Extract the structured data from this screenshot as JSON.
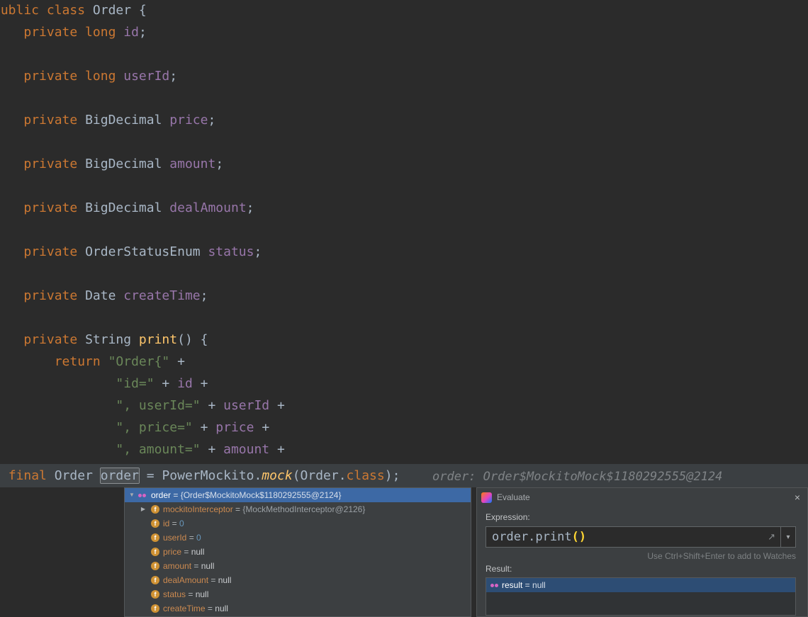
{
  "palette": {
    "editor_bg": "#2b2b2b",
    "panel_bg": "#3c3f41",
    "keyword": "#cc7832",
    "identifier": "#a9b7c6",
    "field": "#9876aa",
    "method": "#ffc66b",
    "string": "#6a8759",
    "number": "#6897bb",
    "selection_blue": "#3d69a5",
    "result_selection_blue": "#2d4d74",
    "execution_line_bg": "#3b3f42"
  },
  "icons": {
    "close": "×",
    "dropdown": "▾",
    "expand": "↗",
    "chevron_expanded": "▼",
    "chevron_collapsed": "▶",
    "field_letter": "f"
  },
  "editor": {
    "lines": [
      [
        {
          "t": "public ",
          "c": "kw"
        },
        {
          "t": "class ",
          "c": "kw"
        },
        {
          "t": "Order ",
          "c": "plain"
        },
        {
          "t": "{",
          "c": "plain"
        }
      ],
      [
        {
          "t": "    ",
          "c": "plain"
        },
        {
          "t": "private long ",
          "c": "kw"
        },
        {
          "t": "id",
          "c": "field"
        },
        {
          "t": ";",
          "c": "plain"
        }
      ],
      [],
      [
        {
          "t": "    ",
          "c": "plain"
        },
        {
          "t": "private long ",
          "c": "kw"
        },
        {
          "t": "userId",
          "c": "field"
        },
        {
          "t": ";",
          "c": "plain"
        }
      ],
      [],
      [
        {
          "t": "    ",
          "c": "plain"
        },
        {
          "t": "private ",
          "c": "kw"
        },
        {
          "t": "BigDecimal ",
          "c": "plain"
        },
        {
          "t": "price",
          "c": "field"
        },
        {
          "t": ";",
          "c": "plain"
        }
      ],
      [],
      [
        {
          "t": "    ",
          "c": "plain"
        },
        {
          "t": "private ",
          "c": "kw"
        },
        {
          "t": "BigDecimal ",
          "c": "plain"
        },
        {
          "t": "amount",
          "c": "field"
        },
        {
          "t": ";",
          "c": "plain"
        }
      ],
      [],
      [
        {
          "t": "    ",
          "c": "plain"
        },
        {
          "t": "private ",
          "c": "kw"
        },
        {
          "t": "BigDecimal ",
          "c": "plain"
        },
        {
          "t": "dealAmount",
          "c": "field"
        },
        {
          "t": ";",
          "c": "plain"
        }
      ],
      [],
      [
        {
          "t": "    ",
          "c": "plain"
        },
        {
          "t": "private ",
          "c": "kw"
        },
        {
          "t": "OrderStatusEnum ",
          "c": "plain"
        },
        {
          "t": "status",
          "c": "field"
        },
        {
          "t": ";",
          "c": "plain"
        }
      ],
      [],
      [
        {
          "t": "    ",
          "c": "plain"
        },
        {
          "t": "private ",
          "c": "kw"
        },
        {
          "t": "Date ",
          "c": "plain"
        },
        {
          "t": "createTime",
          "c": "field"
        },
        {
          "t": ";",
          "c": "plain"
        }
      ],
      [],
      [
        {
          "t": "    ",
          "c": "plain"
        },
        {
          "t": "private ",
          "c": "kw"
        },
        {
          "t": "String ",
          "c": "plain"
        },
        {
          "t": "print",
          "c": "method"
        },
        {
          "t": "() {",
          "c": "plain"
        }
      ],
      [
        {
          "t": "        ",
          "c": "plain"
        },
        {
          "t": "return ",
          "c": "kw"
        },
        {
          "t": "\"Order{\" ",
          "c": "str"
        },
        {
          "t": "+",
          "c": "plain"
        }
      ],
      [
        {
          "t": "                ",
          "c": "plain"
        },
        {
          "t": "\"id=\" ",
          "c": "str"
        },
        {
          "t": "+ ",
          "c": "plain"
        },
        {
          "t": "id ",
          "c": "field"
        },
        {
          "t": "+",
          "c": "plain"
        }
      ],
      [
        {
          "t": "                ",
          "c": "plain"
        },
        {
          "t": "\", userId=\" ",
          "c": "str"
        },
        {
          "t": "+ ",
          "c": "plain"
        },
        {
          "t": "userId ",
          "c": "field"
        },
        {
          "t": "+",
          "c": "plain"
        }
      ],
      [
        {
          "t": "                ",
          "c": "plain"
        },
        {
          "t": "\", price=\" ",
          "c": "str"
        },
        {
          "t": "+ ",
          "c": "plain"
        },
        {
          "t": "price ",
          "c": "field"
        },
        {
          "t": "+",
          "c": "plain"
        }
      ],
      [
        {
          "t": "                ",
          "c": "plain"
        },
        {
          "t": "\", amount=\" ",
          "c": "str"
        },
        {
          "t": "+ ",
          "c": "plain"
        },
        {
          "t": "amount ",
          "c": "field"
        },
        {
          "t": "+",
          "c": "plain"
        }
      ]
    ],
    "exec_line": {
      "segments": [
        {
          "t": "  ",
          "c": "plain"
        },
        {
          "t": "final ",
          "c": "kw"
        },
        {
          "t": "Order ",
          "c": "plain"
        },
        {
          "t": "order",
          "c": "selbox"
        },
        {
          "t": " = PowerMockito.",
          "c": "plain"
        },
        {
          "t": "mock",
          "c": "methodi"
        },
        {
          "t": "(Order.",
          "c": "plain"
        },
        {
          "t": "class",
          "c": "kw"
        },
        {
          "t": ");",
          "c": "plain"
        }
      ],
      "hint": "order: Order$MockitoMock$1180292555@2124"
    }
  },
  "variables_popup": {
    "eq_separator": " = ",
    "rows": [
      {
        "selected": true,
        "chevron": "expanded",
        "icon": "value",
        "indent": 0,
        "name": "order",
        "value": "{Order$MockitoMock$1180292555@2124}",
        "vtype": "obj"
      },
      {
        "chevron": "collapsed",
        "icon": "field",
        "indent": 1,
        "name": "mockitoInterceptor",
        "value": "{MockMethodInterceptor@2126}",
        "vtype": "obj"
      },
      {
        "icon": "field",
        "indent": 1,
        "name": "id",
        "value": "0",
        "vtype": "num"
      },
      {
        "icon": "field",
        "indent": 1,
        "name": "userId",
        "value": "0",
        "vtype": "num"
      },
      {
        "icon": "field",
        "indent": 1,
        "name": "price",
        "value": "null",
        "vtype": "null"
      },
      {
        "icon": "field",
        "indent": 1,
        "name": "amount",
        "value": "null",
        "vtype": "null"
      },
      {
        "icon": "field",
        "indent": 1,
        "name": "dealAmount",
        "value": "null",
        "vtype": "null"
      },
      {
        "icon": "field",
        "indent": 1,
        "name": "status",
        "value": "null",
        "vtype": "null"
      },
      {
        "icon": "field",
        "indent": 1,
        "name": "createTime",
        "value": "null",
        "vtype": "null"
      }
    ]
  },
  "evaluate": {
    "title": "Evaluate",
    "expression_label": "Expression:",
    "expression_segments": [
      {
        "t": "order.print",
        "c": "plain"
      },
      {
        "t": "()",
        "c": "paren"
      }
    ],
    "watches_hint": "Use Ctrl+Shift+Enter to add to Watches",
    "result_label": "Result:",
    "result_row": {
      "name": "result",
      "eq": " = ",
      "value": "null"
    }
  }
}
